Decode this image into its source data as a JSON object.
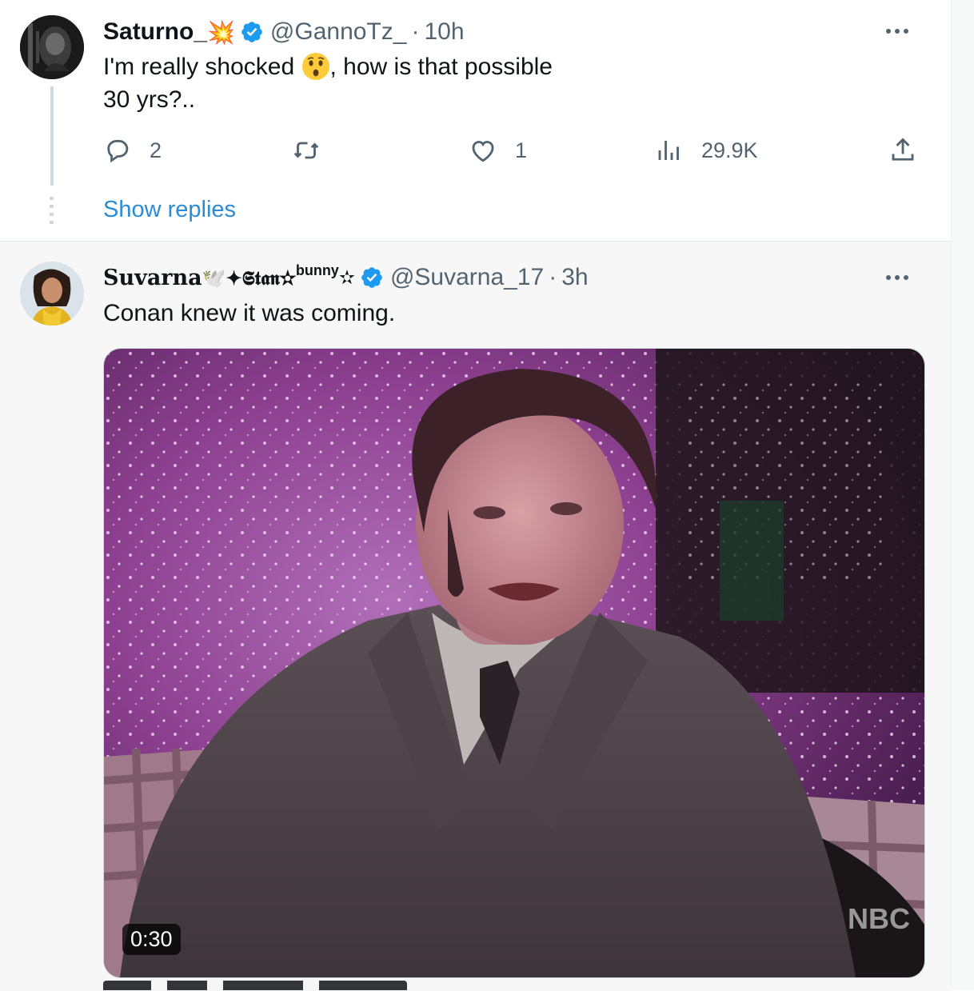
{
  "tweet1": {
    "display_name": "Saturno_",
    "name_emoji": "💥",
    "handle": "@GannoTz_",
    "separator": "·",
    "time": "10h",
    "text_line1_before": "I'm really shocked ",
    "text_line1_after": ", how is that possible",
    "text_line2": "30 yrs?..",
    "reply_count": "2",
    "like_count": "1",
    "view_count": "29.9K",
    "show_replies": "Show replies"
  },
  "tweet2": {
    "display_name": "Suvarna",
    "name_suffix": "🕊️✦𝕾𝖙𝖆𝖓✫",
    "name_sup": "bunny",
    "name_end": "✫",
    "handle": "@Suvarna_17",
    "separator": "·",
    "time": "3h",
    "text": "Conan knew it was coming.",
    "video_duration": "0:30"
  },
  "colors": {
    "accent": "#1d9bf0",
    "secondary_text": "#536471",
    "primary_text": "#0f1419",
    "verified": "#1d9bf0"
  },
  "icons": [
    "reply-icon",
    "retweet-icon",
    "like-icon",
    "views-icon",
    "share-icon",
    "more-icon",
    "verified-badge-icon"
  ]
}
